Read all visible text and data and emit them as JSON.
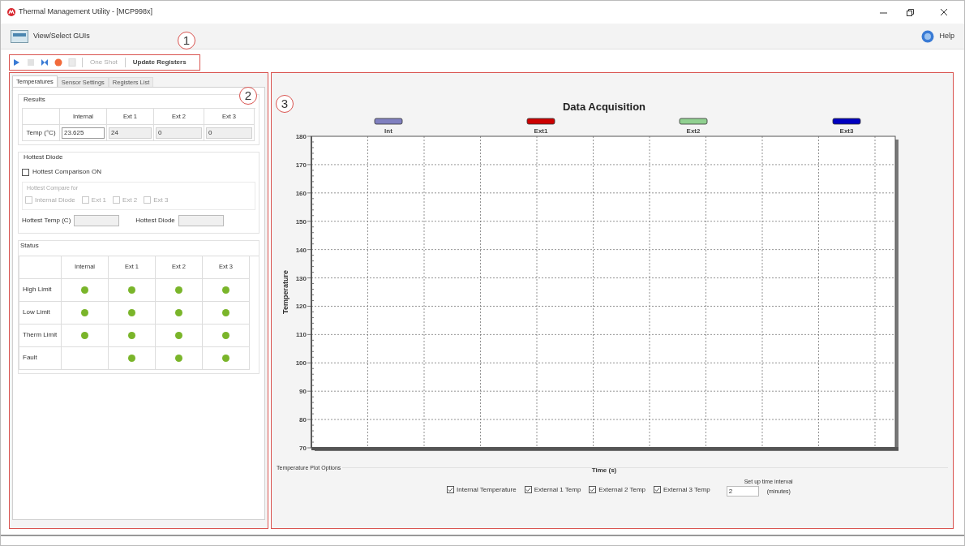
{
  "window": {
    "title": "Thermal Management Utility - [MCP998x]"
  },
  "menu": {
    "view_select": "View/Select GUIs",
    "help": "Help"
  },
  "toolbar": {
    "buttons": [
      {
        "kind": "play",
        "disabled": false
      },
      {
        "kind": "stop",
        "disabled": true
      },
      {
        "kind": "step",
        "disabled": false
      },
      {
        "kind": "record",
        "disabled": false
      },
      {
        "kind": "document",
        "disabled": true
      }
    ],
    "text_buttons": [
      {
        "label": "One Shot",
        "disabled": true
      },
      {
        "label": "Update Registers",
        "disabled": false
      }
    ]
  },
  "callouts": [
    "1",
    "2",
    "3"
  ],
  "tabs": [
    {
      "label": "Temperatures",
      "selected": true
    },
    {
      "label": "Sensor Settings",
      "selected": false
    },
    {
      "label": "Registers List",
      "selected": false
    }
  ],
  "results": {
    "title": "Results",
    "columns": [
      "Internal",
      "Ext 1",
      "Ext 2",
      "Ext 3"
    ],
    "row_label": "Temp (°C)",
    "values": [
      {
        "value": "23.625",
        "disabled": false
      },
      {
        "value": "24",
        "disabled": true
      },
      {
        "value": "0",
        "disabled": true
      },
      {
        "value": "0",
        "disabled": true
      }
    ]
  },
  "hottest": {
    "title": "Hottest Diode",
    "comparison": {
      "label": "Hottest Comparison ON",
      "checked": false
    },
    "compare_title": "Hottest Compare for",
    "compare": [
      {
        "label": "Internal Diode",
        "checked": false,
        "disabled": true
      },
      {
        "label": "Ext 1",
        "checked": false,
        "disabled": true
      },
      {
        "label": "Ext 2",
        "checked": false,
        "disabled": true
      },
      {
        "label": "Ext 3",
        "checked": false,
        "disabled": true
      }
    ],
    "temp_label": "Hottest Temp (C)",
    "diode_label": "Hottest Diode"
  },
  "status": {
    "title": "Status",
    "columns": [
      "Internal",
      "Ext 1",
      "Ext 2",
      "Ext 3"
    ],
    "rows": [
      {
        "label": "High Limit",
        "lit": [
          true,
          true,
          true,
          true
        ]
      },
      {
        "label": "Low Limit",
        "lit": [
          true,
          true,
          true,
          true
        ]
      },
      {
        "label": "Therm Limit",
        "lit": [
          true,
          true,
          true,
          true
        ]
      },
      {
        "label": "Fault",
        "lit": [
          false,
          true,
          true,
          true
        ]
      }
    ]
  },
  "chart": {
    "chart_data": {
      "type": "line",
      "grid": true,
      "title": "Data Acquisition",
      "xlabel": "Time (s)",
      "ylabel": "Temperature",
      "ylim": [
        70,
        180
      ],
      "yticks": [
        70,
        80,
        90,
        100,
        110,
        120,
        130,
        140,
        150,
        160,
        170,
        180
      ],
      "series": [
        {
          "name": "Int",
          "color": "#8080c0"
        },
        {
          "name": "Ext1",
          "color": "#cc0000"
        },
        {
          "name": "Ext2",
          "color": "#90d090"
        },
        {
          "name": "Ext3",
          "color": "#0000c0"
        }
      ]
    }
  },
  "plot_options": {
    "title": "Temperature Plot Options",
    "options": [
      {
        "label": "Internal Temperature",
        "checked": true
      },
      {
        "label": "External 1 Temp",
        "checked": true
      },
      {
        "label": "External 2 Temp",
        "checked": true
      },
      {
        "label": "External 3 Temp",
        "checked": true
      }
    ],
    "interval_label": "Set up time interval",
    "interval_value": "2",
    "interval_unit": "(minutes)"
  }
}
